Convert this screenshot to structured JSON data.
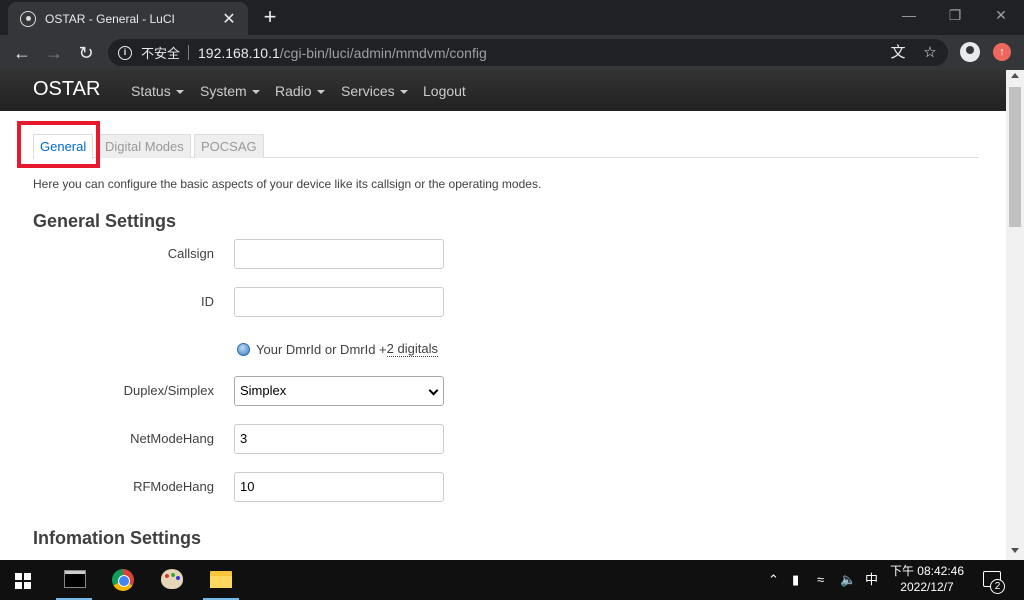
{
  "browser": {
    "tab_title": "OSTAR - General - LuCI",
    "tab_close": "✕",
    "new_tab": "+",
    "security_label": "不安全",
    "url_host": "192.168.10.1",
    "url_path": "/cgi-bin/luci/admin/mmdvm/config",
    "window_minimize": "—",
    "window_restore": "❐",
    "window_close": "✕"
  },
  "header": {
    "brand": "OSTAR",
    "menu": [
      {
        "label": "Status"
      },
      {
        "label": "System"
      },
      {
        "label": "Radio"
      },
      {
        "label": "Services"
      },
      {
        "label": "Logout"
      }
    ]
  },
  "tabs": [
    {
      "label": "General",
      "active": true
    },
    {
      "label": "Digital Modes",
      "active": false
    },
    {
      "label": "POCSAG",
      "active": false
    }
  ],
  "description": "Here you can configure the basic aspects of your device like its callsign or the operating modes.",
  "general_settings": {
    "title": "General Settings",
    "callsign": {
      "label": "Callsign",
      "value": ""
    },
    "id": {
      "label": "ID",
      "value": ""
    },
    "id_hint_prefix": "Your DmrId or DmrId + ",
    "id_hint_link": "2 digitals",
    "duplex": {
      "label": "Duplex/Simplex",
      "value": "Simplex"
    },
    "netmodehang": {
      "label": "NetModeHang",
      "value": "3"
    },
    "rfmodehang": {
      "label": "RFModeHang",
      "value": "10"
    }
  },
  "information_settings": {
    "title": "Infomation Settings"
  },
  "taskbar": {
    "ime": "中",
    "time": "下午 08:42:46",
    "date": "2022/12/7",
    "notification_count": "2"
  },
  "colors": {
    "highlight_box": "#e8192c",
    "active_tab_text": "#0069d6"
  }
}
